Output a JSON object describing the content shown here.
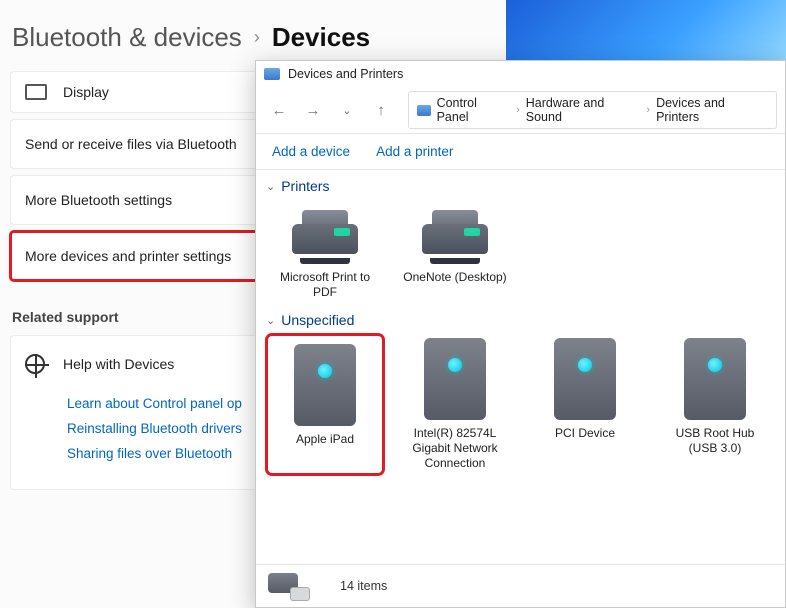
{
  "settings": {
    "breadcrumb_parent": "Bluetooth & devices",
    "breadcrumb_current": "Devices",
    "items": {
      "display": "Display",
      "send_receive": "Send or receive files via Bluetooth",
      "more_bt": "More Bluetooth settings",
      "more_devices": "More devices and printer settings"
    },
    "related_support_label": "Related support",
    "help_with_devices": "Help with Devices",
    "links": {
      "learn_cp": "Learn about Control panel op",
      "reinstall": "Reinstalling Bluetooth drivers",
      "sharing": "Sharing files over Bluetooth"
    }
  },
  "explorer": {
    "title": "Devices and Printers",
    "address": [
      "Control Panel",
      "Hardware and Sound",
      "Devices and Printers"
    ],
    "toolbar": {
      "add_device": "Add a device",
      "add_printer": "Add a printer"
    },
    "groups": {
      "printers": {
        "label": "Printers",
        "items": [
          {
            "name": "Microsoft Print to PDF"
          },
          {
            "name": "OneNote (Desktop)"
          }
        ]
      },
      "unspecified": {
        "label": "Unspecified",
        "items": [
          {
            "name": "Apple iPad"
          },
          {
            "name": "Intel(R) 82574L Gigabit Network Connection"
          },
          {
            "name": "PCI Device"
          },
          {
            "name": "USB Root Hub (USB 3.0)"
          }
        ]
      }
    },
    "status": {
      "count_text": "14 items"
    }
  }
}
